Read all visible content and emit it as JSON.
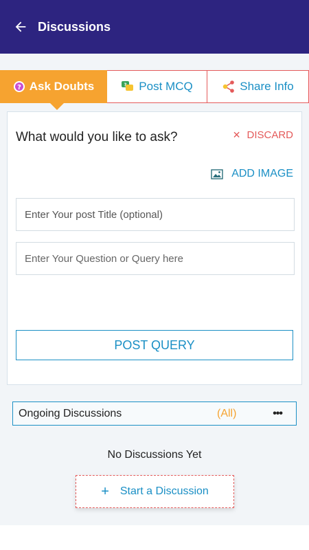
{
  "appbar": {
    "title": "Discussions",
    "back_icon": "arrow-left-icon"
  },
  "tabs": [
    {
      "label": "Ask Doubts",
      "icon": "question-badge-icon",
      "active": true
    },
    {
      "label": "Post MCQ",
      "icon": "chat-bubbles-icon",
      "active": false
    },
    {
      "label": "Share Info",
      "icon": "share-icon",
      "active": false
    }
  ],
  "ask": {
    "heading": "What would you like to ask?",
    "discard_label": "DISCARD",
    "add_image_label": "ADD IMAGE",
    "title_placeholder": "Enter Your post Title (optional)",
    "query_placeholder": "Enter Your Question or Query here",
    "post_label": "POST QUERY"
  },
  "ongoing": {
    "label": "Ongoing Discussions",
    "filter": "(All)",
    "more": "•••"
  },
  "empty": {
    "message": "No Discussions Yet",
    "start_label": "Start a Discussion",
    "start_icon": "+"
  },
  "colors": {
    "appbar": "#2d2480",
    "accent_orange": "#f6a330",
    "accent_blue": "#1a8fc5",
    "danger": "#e45a5a"
  }
}
